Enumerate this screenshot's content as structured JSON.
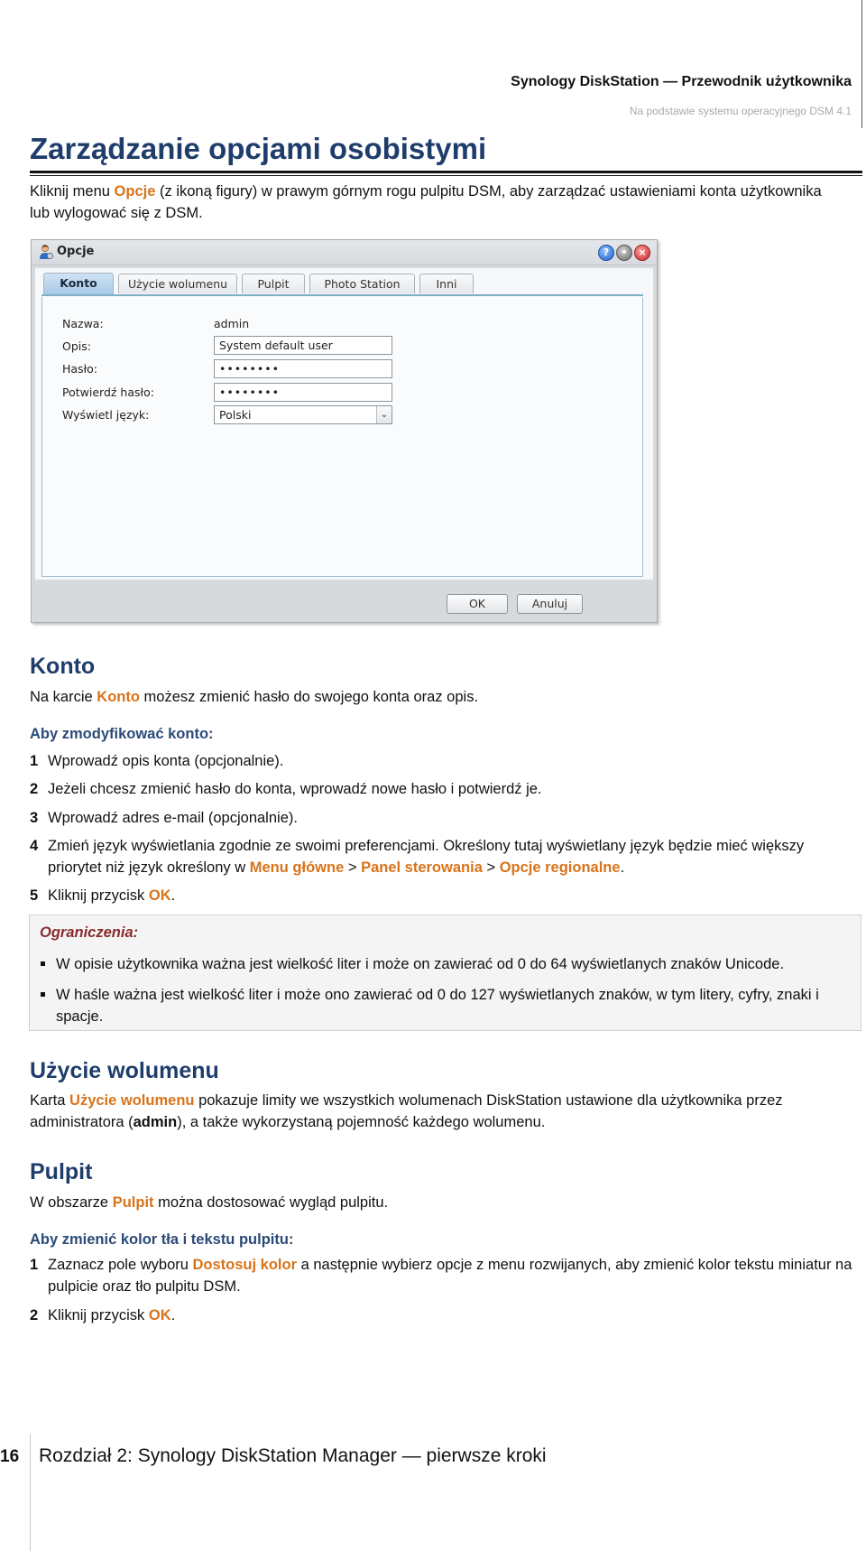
{
  "header": {
    "title": "Synology DiskStation — Przewodnik użytkownika",
    "subtitle": "Na podstawie systemu operacyjnego DSM 4.1"
  },
  "page_title": "Zarządzanie opcjami osobistymi",
  "intro": {
    "before": "Kliknij menu ",
    "highlight": "Opcje",
    "after": " (z ikoną figury) w prawym górnym rogu pulpitu DSM, aby zarządzać ustawieniami konta użytkownika lub wylogować się z DSM."
  },
  "dialog": {
    "title": "Opcje",
    "icons": [
      "user-icon",
      "help-icon",
      "minimize-icon",
      "close-icon"
    ],
    "tabs": [
      {
        "label": "Konto",
        "active": true
      },
      {
        "label": "Użycie wolumenu",
        "active": false
      },
      {
        "label": "Pulpit",
        "active": false
      },
      {
        "label": "Photo Station",
        "active": false
      },
      {
        "label": "Inni",
        "active": false
      }
    ],
    "fields": {
      "name_label": "Nazwa:",
      "name_value": "admin",
      "description_label": "Opis:",
      "description_value": "System default user",
      "password_label": "Hasło:",
      "password_value": "••••••••",
      "confirm_label": "Potwierdź hasło:",
      "confirm_value": "••••••••",
      "language_label": "Wyświetl język:",
      "language_value": "Polski"
    },
    "ok_label": "OK",
    "cancel_label": "Anuluj"
  },
  "konto": {
    "heading": "Konto",
    "desc_before": "Na karcie ",
    "desc_highlight": "Konto",
    "desc_after": " możesz zmienić hasło do swojego konta oraz opis.",
    "subheading": "Aby zmodyfikować konto:",
    "steps": [
      {
        "num": "1",
        "text": "Wprowadź opis konta (opcjonalnie)."
      },
      {
        "num": "2",
        "text": "Jeżeli chcesz zmienić hasło do konta, wprowadź nowe hasło i potwierdź je."
      },
      {
        "num": "3",
        "text": "Wprowadź adres e-mail (opcjonalnie)."
      },
      {
        "num": "4",
        "text": "Zmień język wyświetlania zgodnie ze swoimi preferencjami. Określony tutaj wyświetlany język będzie mieć większy priorytet niż język określony w ",
        "link1": "Menu główne",
        "sep1": " > ",
        "link2": "Panel sterowania",
        "sep2": " > ",
        "link3": "Opcje regionalne",
        "end": "."
      },
      {
        "num": "5",
        "text": "Kliknij przycisk ",
        "link": "OK",
        "end": "."
      }
    ]
  },
  "limits": {
    "title": "Ograniczenia:",
    "items": [
      "W opisie użytkownika ważna jest wielkość liter i może on zawierać od 0 do 64 wyświetlanych znaków Unicode.",
      "W haśle ważna jest wielkość liter i może ono zawierać od 0 do 127 wyświetlanych znaków, w tym litery, cyfry, znaki i spacje."
    ]
  },
  "volume": {
    "heading": "Użycie wolumenu",
    "before": "Karta ",
    "highlight": "Użycie wolumenu",
    "middle": " pokazuje limity we wszystkich wolumenach DiskStation ustawione dla użytkownika przez administratora (",
    "bold": "admin",
    "after": "), a także wykorzystaną pojemność każdego wolumenu."
  },
  "pulpit": {
    "heading": "Pulpit",
    "desc_before": "W obszarze ",
    "desc_highlight": "Pulpit",
    "desc_after": " można dostosować wygląd pulpitu.",
    "subheading": "Aby zmienić kolor tła i tekstu pulpitu:",
    "steps": [
      {
        "num": "1",
        "before": "Zaznacz pole wyboru ",
        "link": "Dostosuj kolor",
        "after": " a następnie wybierz opcje z menu rozwijanych, aby zmienić kolor tekstu miniatur na pulpicie oraz tło pulpitu DSM."
      },
      {
        "num": "2",
        "before": "Kliknij przycisk ",
        "link": "OK",
        "after": "."
      }
    ]
  },
  "footer": {
    "page_number": "16",
    "chapter": "Rozdział 2: Synology DiskStation Manager — pierwsze kroki"
  },
  "colors": {
    "heading_blue": "#1f3d6b",
    "highlight_orange": "#d9731a",
    "note_title_red": "#8a2a2a"
  }
}
